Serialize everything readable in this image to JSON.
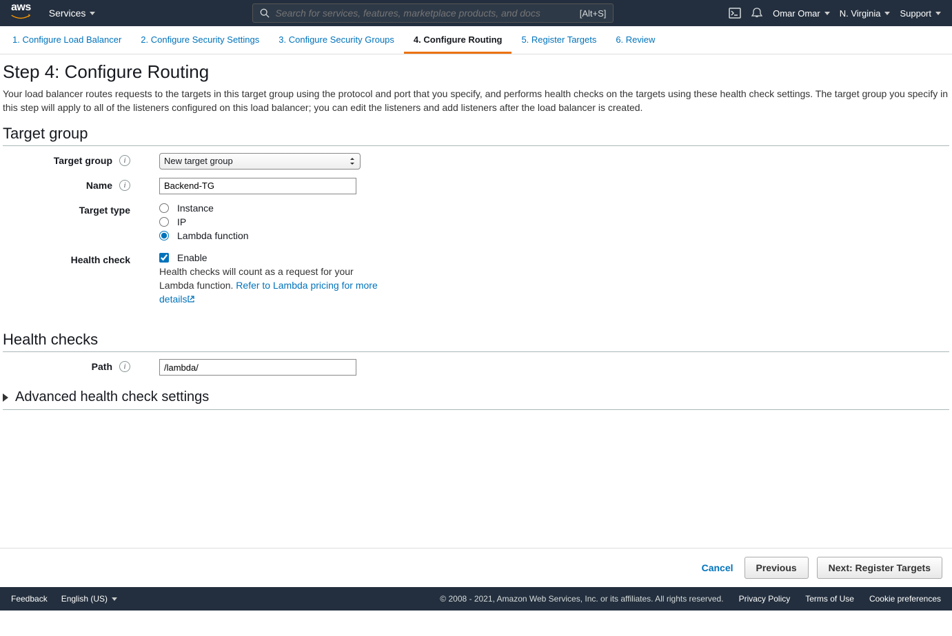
{
  "nav": {
    "services": "Services",
    "search_placeholder": "Search for services, features, marketplace products, and docs",
    "search_shortcut": "[Alt+S]",
    "user": "Omar Omar",
    "region": "N. Virginia",
    "support": "Support"
  },
  "wizard": {
    "t1": "1. Configure Load Balancer",
    "t2": "2. Configure Security Settings",
    "t3": "3. Configure Security Groups",
    "t4": "4. Configure Routing",
    "t5": "5. Register Targets",
    "t6": "6. Review"
  },
  "step": {
    "title": "Step 4: Configure Routing",
    "desc": "Your load balancer routes requests to the targets in this target group using the protocol and port that you specify, and performs health checks on the targets using these health check settings. The target group you specify in this step will apply to all of the listeners configured on this load balancer; you can edit the listeners and add listeners after the load balancer is created."
  },
  "sections": {
    "target_group": "Target group",
    "health_checks": "Health checks"
  },
  "labels": {
    "target_group": "Target group",
    "name": "Name",
    "target_type": "Target type",
    "health_check": "Health check",
    "path": "Path"
  },
  "form": {
    "target_group_selected": "New target group",
    "name_value": "Backend-TG",
    "type_instance": "Instance",
    "type_ip": "IP",
    "type_lambda": "Lambda function",
    "hc_enable": "Enable",
    "hc_note_1": "Health checks will count as a request for your Lambda function. ",
    "hc_link": "Refer to Lambda pricing for more details",
    "path_value": "/lambda/"
  },
  "advanced": "Advanced health check settings",
  "actions": {
    "cancel": "Cancel",
    "previous": "Previous",
    "next": "Next: Register Targets"
  },
  "footer": {
    "feedback": "Feedback",
    "lang": "English (US)",
    "copyright": "© 2008 - 2021, Amazon Web Services, Inc. or its affiliates. All rights reserved.",
    "privacy": "Privacy Policy",
    "terms": "Terms of Use",
    "cookie": "Cookie preferences"
  }
}
